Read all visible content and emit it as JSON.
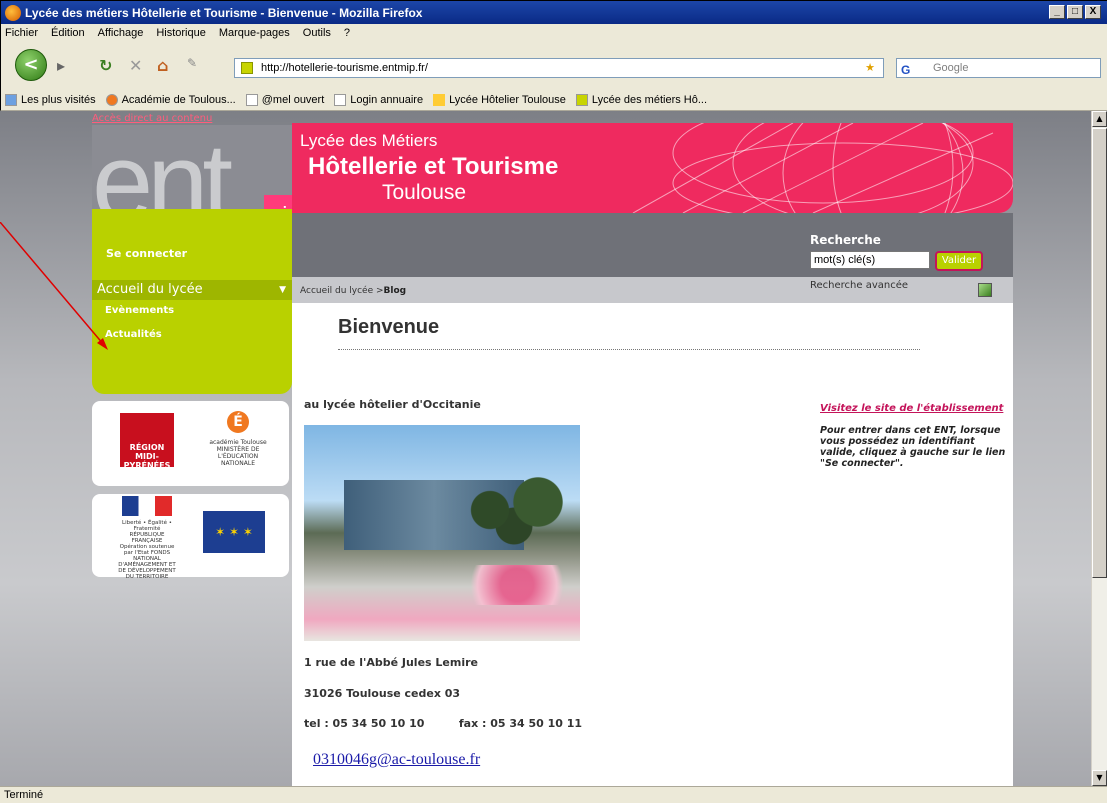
{
  "window": {
    "title": "Lycée des métiers Hôtellerie et Tourisme - Bienvenue - Mozilla Firefox",
    "buttons": [
      "_",
      "□",
      "X"
    ]
  },
  "menu": [
    "Fichier",
    "Édition",
    "Affichage",
    "Historique",
    "Marque-pages",
    "Outils",
    "?"
  ],
  "toolbar": {
    "back_glyph": "<",
    "url": "http://hotellerie-tourisme.entmip.fr/",
    "search_placeholder": "Google",
    "search_engine_glyph": "G"
  },
  "bookmarks": [
    "Les plus visités",
    "Académie de Toulous...",
    "@mel ouvert",
    "Login annuaire",
    "Lycée Hôtelier Toulouse",
    "Lycée des métiers Hô..."
  ],
  "site": {
    "skip_link": "Accès direct au contenu",
    "logo_text": "ent",
    "logo_badge": "mip",
    "header": {
      "line1": "Lycée des Métiers",
      "line2": "Hôtellerie et Tourisme",
      "line3": "Toulouse"
    },
    "connect_label": "Se connecter",
    "nav": {
      "section": "Accueil du lycée",
      "items": [
        "Evènements",
        "Actualités"
      ]
    },
    "search": {
      "label": "Recherche",
      "input_value": "mot(s) clé(s)",
      "button": "Valider",
      "advanced": "Recherche avancée"
    },
    "breadcrumb": {
      "parent": "Accueil du lycée >",
      "current": "Blog"
    },
    "partners": {
      "region_name": "RÉGION MIDI-PYRÉNÉES",
      "academie": "académie Toulouse",
      "ministere": "MINISTÈRE DE L'ÉDUCATION NATIONALE",
      "rf": "Liberté • Égalité • Fraternité RÉPUBLIQUE FRANÇAISE",
      "rf_sub": "Opération soutenue par l'Etat FONDS NATIONAL D'AMÉNAGEMENT ET DE DÉVELOPPEMENT DU TERRITOIRE"
    },
    "page_title": "Bienvenue",
    "subtitle": "au lycée hôtelier d'Occitanie",
    "address": {
      "street": "1 rue de l'Abbé Jules Lemire",
      "city": "31026 Toulouse cedex 03",
      "phones": "tel : 05 34 50 10 10         fax : 05 34 50 10 11",
      "email": "0310046g@ac-toulouse.fr"
    },
    "sidebar_right": {
      "visit_link": "Visitez le site de l'établissement",
      "info": "Pour entrer dans cet ENT, lorsque vous possédez un identifiant valide, cliquez à gauche sur le lien \"Se connecter\"."
    }
  },
  "status": "Terminé"
}
